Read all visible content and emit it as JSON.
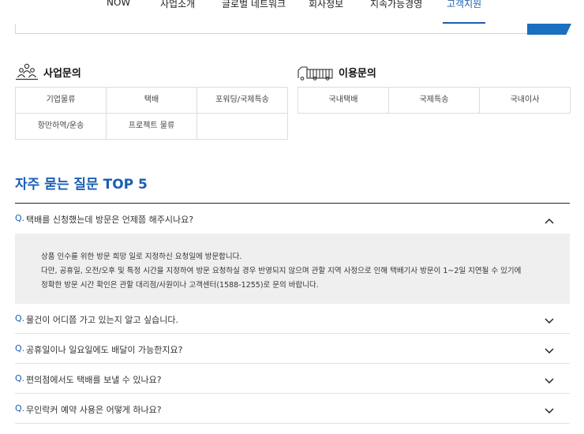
{
  "nav": {
    "items": [
      "NOW",
      "사업소개",
      "글로벌 네트워크",
      "회사정보",
      "지속가능경영",
      "고객지원"
    ],
    "active_index": 5
  },
  "business_inquiry": {
    "title": "사업문의",
    "icon": "people-group-icon",
    "items": [
      "기업물류",
      "택배",
      "포워딩/국제특송",
      "항만하역/운송",
      "프로젝트 물류",
      ""
    ]
  },
  "usage_inquiry": {
    "title": "이용문의",
    "icon": "truck-icon",
    "items": [
      "국내택배",
      "국제특송",
      "국내이사"
    ]
  },
  "faq": {
    "heading": "자주 묻는 질문 TOP 5",
    "q_marker": "Q.",
    "items": [
      {
        "question": "택배를 신청했는데 방문은 언제쯤 해주시나요?",
        "expanded": true,
        "answer_lines": [
          "상품 인수를 위한 방문 희망 일로 지정하신 요청일에 방문합니다.",
          "다만, 공휴일, 오전/오후 및 특정 시간을 지정하여 방문 요청하실 경우 반영되지 않으며 관할 지역 사정으로 인해 택배기사 방문이 1~2일 지연될 수 있기에",
          "정확한 방문 시간 확인은 관할 대리점/사원이나 고객센터(1588-1255)로 문의 바랍니다."
        ]
      },
      {
        "question": "물건이 어디쯤 가고 있는지 알고 싶습니다.",
        "expanded": false
      },
      {
        "question": "공휴일이나 일요일에도 배달이 가능한지요?",
        "expanded": false
      },
      {
        "question": "편의점에서도 택배를 보낼 수 있나요?",
        "expanded": false
      },
      {
        "question": "무인락커 예약 사용은 어떻게 하나요?",
        "expanded": false
      }
    ]
  },
  "colors": {
    "accent": "#1a5fb4",
    "answer_bg": "#efefef"
  }
}
